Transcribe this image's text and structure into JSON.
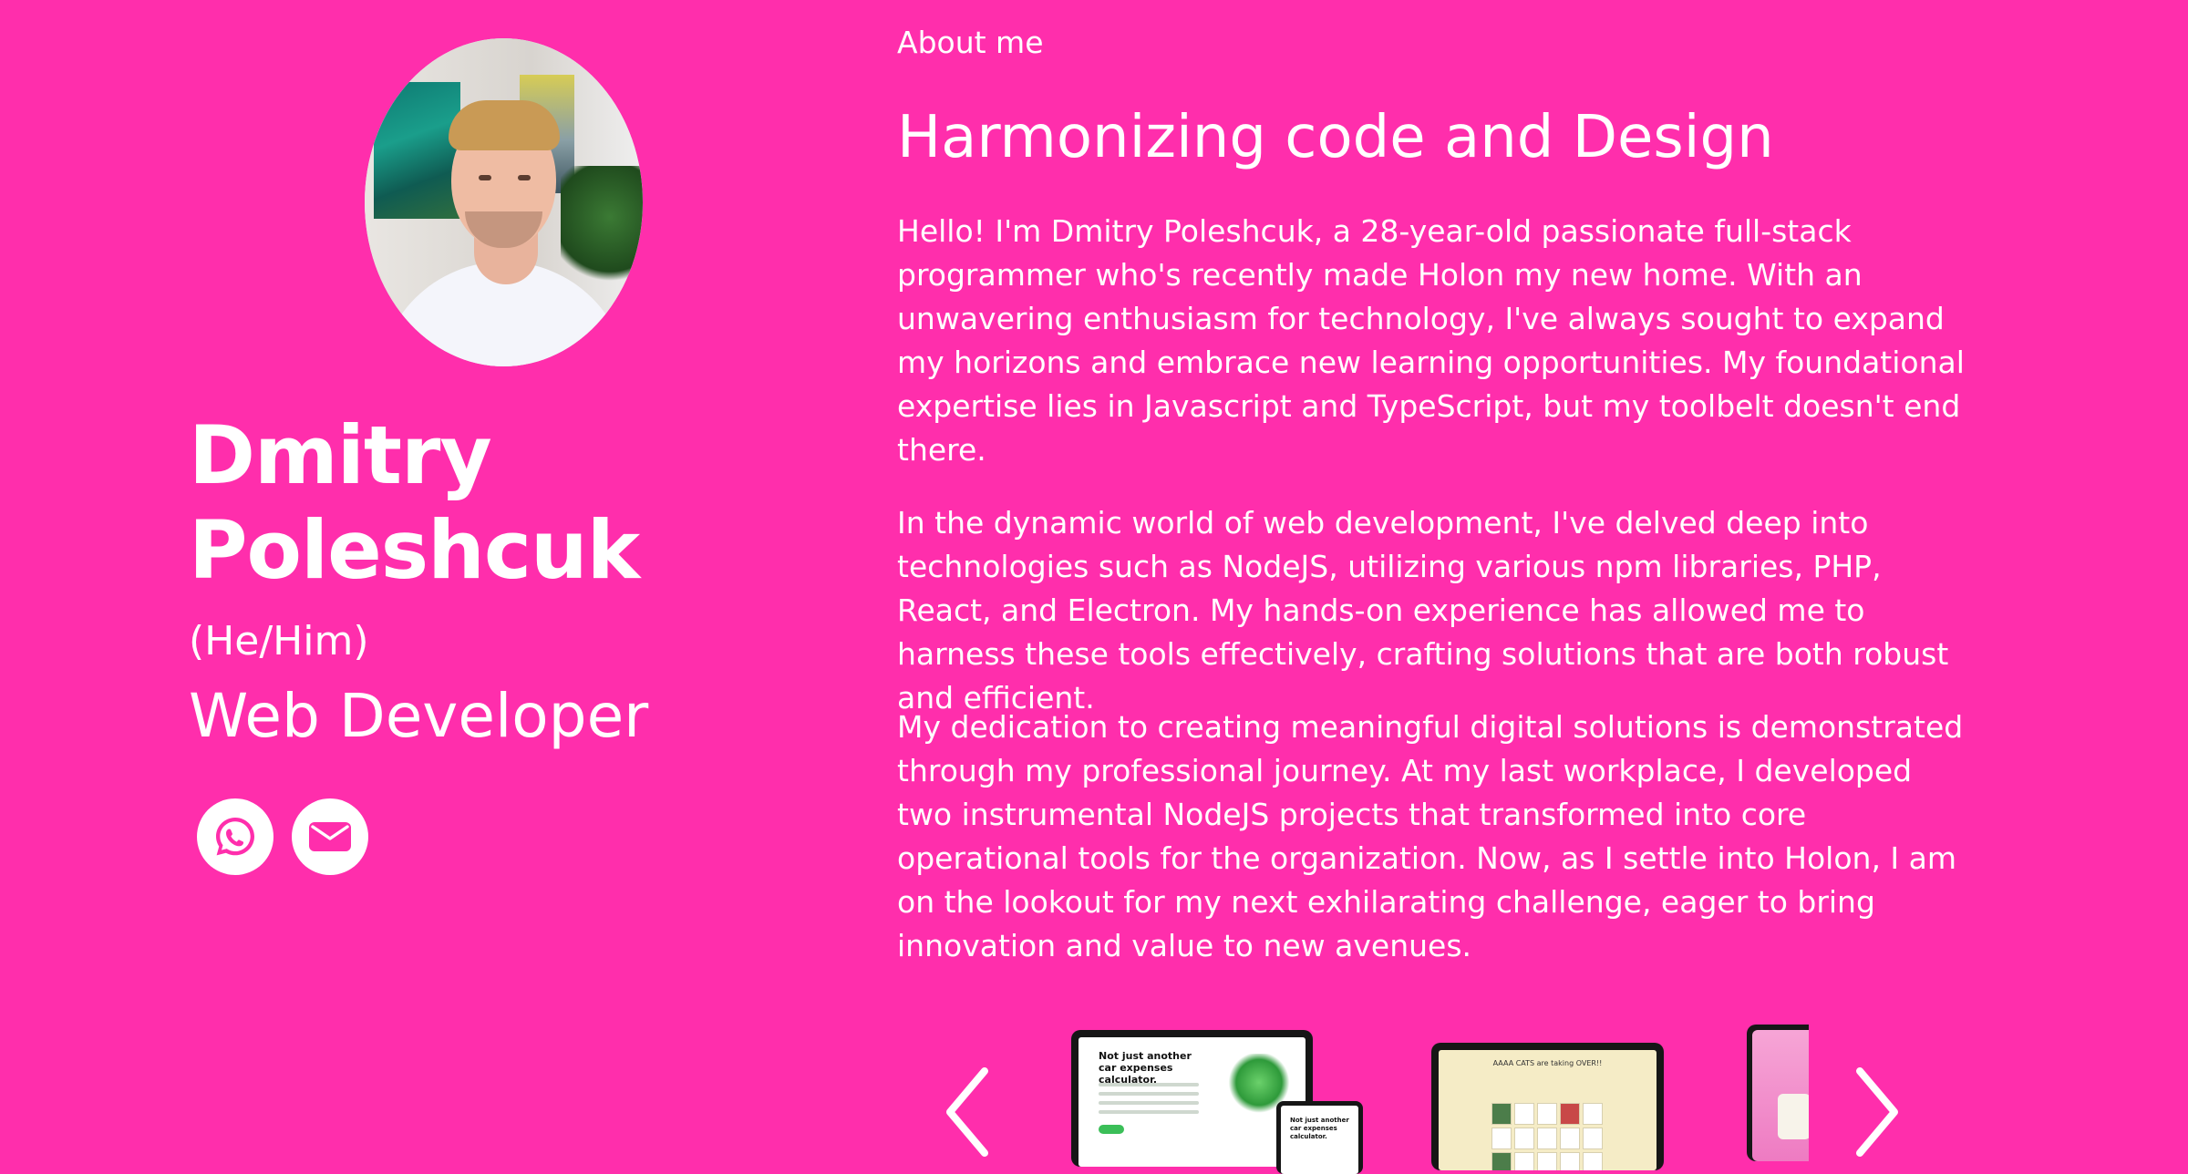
{
  "profile": {
    "name_line1": "Dmitry",
    "name_line2": "Poleshcuk",
    "pronouns": "(He/Him)",
    "role": "Web Developer",
    "photo_icon": "profile-photo",
    "socials": [
      {
        "icon": "whatsapp-icon"
      },
      {
        "icon": "mail-icon"
      }
    ]
  },
  "about": {
    "label": "About me",
    "headline": "Harmonizing code and Design",
    "paragraphs": [
      "Hello! I'm Dmitry Poleshcuk, a 28-year-old passionate full-stack programmer who's recently made Holon my new home. With an unwavering enthusiasm for technology, I've always sought to expand my horizons and embrace new learning opportunities. My foundational expertise lies in Javascript and TypeScript, but my toolbelt doesn't end there.",
      "In the dynamic world of web development, I've delved deep into technologies such as NodeJS, utilizing various npm libraries, PHP, React, and Electron. My hands-on experience has allowed me to harness these tools effectively, crafting solutions that are both robust and efficient.",
      "My dedication to creating meaningful digital solutions is demonstrated through my professional journey. At my last workplace, I developed two instrumental NodeJS projects that transformed into core operational tools for the organization. Now, as I settle into Holon, I am on the lookout for my next exhilarating challenge, eager to bring innovation and value to new avenues."
    ]
  },
  "carousel": {
    "prev_icon": "chevron-left-icon",
    "next_icon": "chevron-right-icon",
    "slides": [
      {
        "title": "Not just another car expenses calculator.",
        "secondary_title": "Not just another car expenses calculator."
      },
      {
        "title": "AAAA CATS are taking OVER!!"
      },
      {
        "title": ""
      }
    ]
  },
  "colors": {
    "background": "#ff2eac",
    "text": "#ffffff",
    "icon_fg": "#ff2eac"
  }
}
